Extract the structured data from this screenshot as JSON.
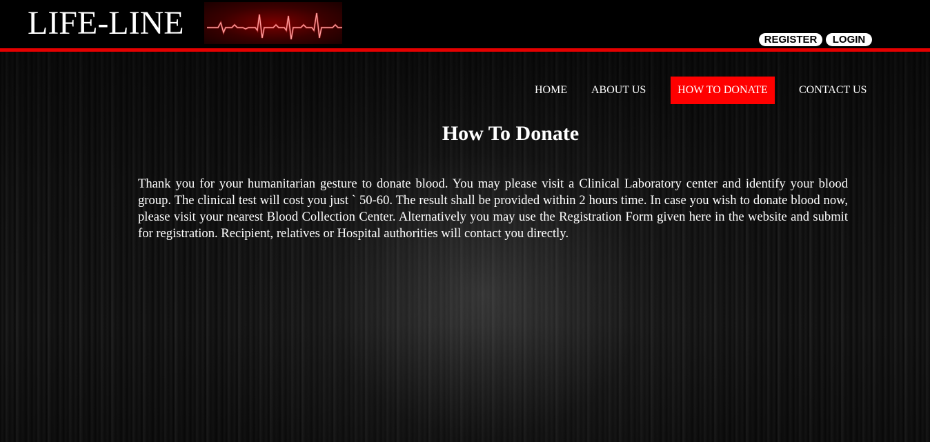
{
  "header": {
    "logo_text": "LIFE-LINE",
    "logo_graphic": "ecg-heartbeat-icon",
    "register_label": "REGISTER",
    "login_label": "LOGIN",
    "accent_color": "#e50000"
  },
  "nav": {
    "items": [
      {
        "label": "HOME",
        "active": false
      },
      {
        "label": "ABOUT US",
        "active": false
      },
      {
        "label": "HOW TO DONATE",
        "active": true
      },
      {
        "label": "CONTACT US",
        "active": false
      }
    ],
    "active_color": "#ff0000"
  },
  "main": {
    "title": "How To Donate",
    "body": "Thank you for your humanitarian gesture to donate blood. You may please visit a Clinical Laboratory center and identify your blood group. The clinical test will cost you just ` 50-60. The result shall be provided within 2 hours time. In case you wish to donate blood now, please visit your nearest Blood Collection Center. Alternatively you may use the Registration Form given here in the website and submit for registration. Recipient, relatives or Hospital authorities will contact you directly."
  }
}
